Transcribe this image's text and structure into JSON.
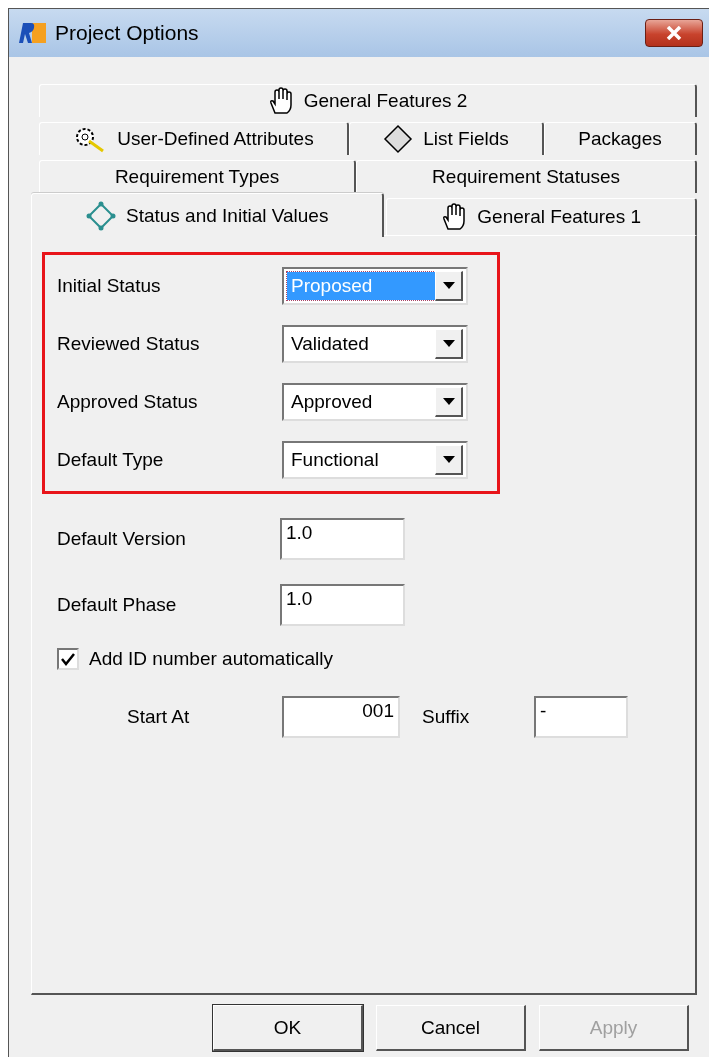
{
  "window": {
    "title": "Project Options"
  },
  "tab_rows": [
    [
      {
        "label": "General Features 2",
        "kind": "hand",
        "selected": false
      }
    ],
    [
      {
        "label": "User-Defined Attributes",
        "kind": "gear",
        "selected": false
      },
      {
        "label": "List Fields",
        "kind": "diamond",
        "selected": false
      },
      {
        "label": "Packages",
        "kind": "plain",
        "selected": false
      }
    ],
    [
      {
        "label": "Requirement Types",
        "kind": "plain",
        "selected": false
      },
      {
        "label": "Requirement Statuses",
        "kind": "plain",
        "selected": false
      }
    ],
    [
      {
        "label": "Status and Initial Values",
        "kind": "nodes",
        "selected": true
      },
      {
        "label": "General Features 1",
        "kind": "hand",
        "selected": false
      }
    ]
  ],
  "highlighted_group": {
    "highlighted": true,
    "fields": [
      {
        "label": "Initial Status",
        "value": "Proposed",
        "focused": true
      },
      {
        "label": "Reviewed Status",
        "value": "Validated",
        "focused": false
      },
      {
        "label": "Approved Status",
        "value": "Approved",
        "focused": false
      },
      {
        "label": "Default Type",
        "value": "Functional",
        "focused": false
      }
    ]
  },
  "text_fields": [
    {
      "label": "Default Version",
      "value": "1.0"
    },
    {
      "label": "Default Phase",
      "value": "1.0"
    }
  ],
  "auto_id": {
    "label": "Add ID number automatically",
    "checked": true
  },
  "start_at": {
    "label": "Start At",
    "value": "001"
  },
  "suffix": {
    "label": "Suffix",
    "value": "-"
  },
  "buttons": [
    {
      "label": "OK",
      "default": true,
      "disabled": false
    },
    {
      "label": "Cancel",
      "default": false,
      "disabled": false
    },
    {
      "label": "Apply",
      "default": false,
      "disabled": true
    }
  ]
}
